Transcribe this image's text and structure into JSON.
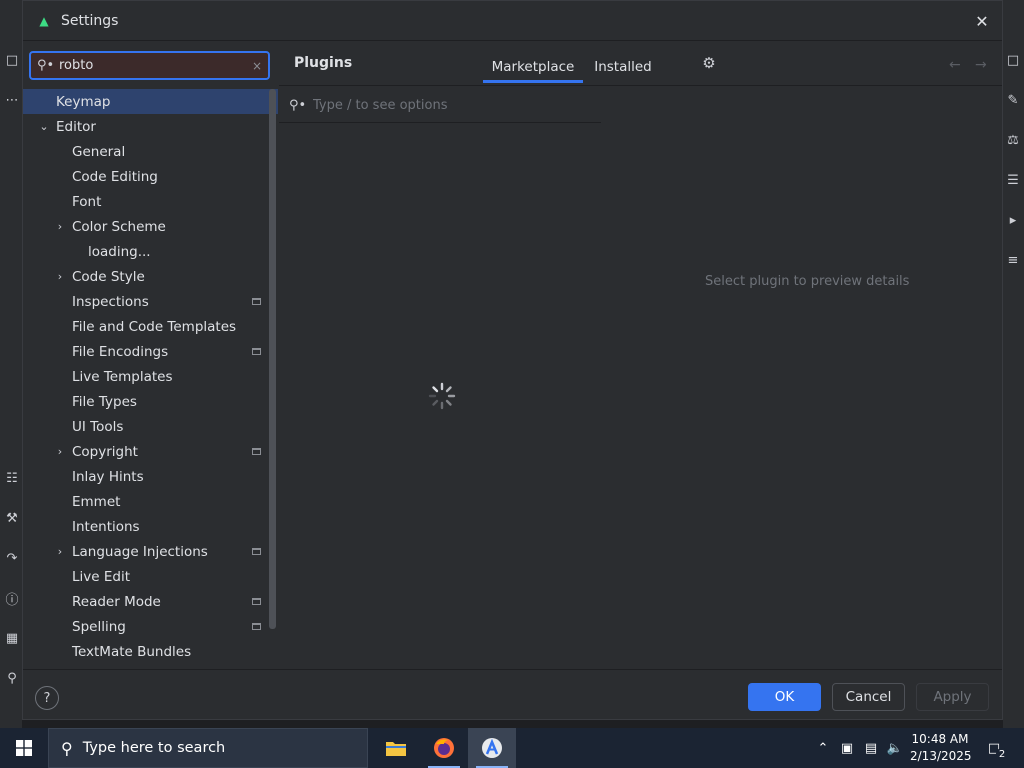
{
  "dialog": {
    "title": "Settings",
    "close_label": "✕"
  },
  "search": {
    "value": "robto",
    "clear_label": "×"
  },
  "tree": {
    "items": [
      {
        "label": "Keymap",
        "level": 0,
        "expandable": false,
        "selected": true,
        "project_icon": false
      },
      {
        "label": "Editor",
        "level": 0,
        "expandable": true,
        "expanded": true,
        "project_icon": false
      },
      {
        "label": "General",
        "level": 1,
        "expandable": false,
        "project_icon": false
      },
      {
        "label": "Code Editing",
        "level": 1,
        "expandable": false,
        "project_icon": false
      },
      {
        "label": "Font",
        "level": 1,
        "expandable": false,
        "project_icon": false
      },
      {
        "label": "Color Scheme",
        "level": 1,
        "expandable": true,
        "expanded": false,
        "project_icon": false
      },
      {
        "label": "loading...",
        "level": 2,
        "expandable": false,
        "project_icon": false
      },
      {
        "label": "Code Style",
        "level": 1,
        "expandable": true,
        "expanded": false,
        "project_icon": false
      },
      {
        "label": "Inspections",
        "level": 1,
        "expandable": false,
        "project_icon": true
      },
      {
        "label": "File and Code Templates",
        "level": 1,
        "expandable": false,
        "project_icon": false
      },
      {
        "label": "File Encodings",
        "level": 1,
        "expandable": false,
        "project_icon": true
      },
      {
        "label": "Live Templates",
        "level": 1,
        "expandable": false,
        "project_icon": false
      },
      {
        "label": "File Types",
        "level": 1,
        "expandable": false,
        "project_icon": false
      },
      {
        "label": "UI Tools",
        "level": 1,
        "expandable": false,
        "project_icon": false
      },
      {
        "label": "Copyright",
        "level": 1,
        "expandable": true,
        "expanded": false,
        "project_icon": true
      },
      {
        "label": "Inlay Hints",
        "level": 1,
        "expandable": false,
        "project_icon": false
      },
      {
        "label": "Emmet",
        "level": 1,
        "expandable": false,
        "project_icon": false
      },
      {
        "label": "Intentions",
        "level": 1,
        "expandable": false,
        "project_icon": false
      },
      {
        "label": "Language Injections",
        "level": 1,
        "expandable": true,
        "expanded": false,
        "project_icon": true
      },
      {
        "label": "Live Edit",
        "level": 1,
        "expandable": false,
        "project_icon": false
      },
      {
        "label": "Reader Mode",
        "level": 1,
        "expandable": false,
        "project_icon": true
      },
      {
        "label": "Spelling",
        "level": 1,
        "expandable": false,
        "project_icon": true
      },
      {
        "label": "TextMate Bundles",
        "level": 1,
        "expandable": false,
        "project_icon": false
      }
    ]
  },
  "plugins": {
    "title": "Plugins",
    "tabs": [
      {
        "label": "Marketplace",
        "active": true
      },
      {
        "label": "Installed",
        "active": false
      }
    ],
    "search_placeholder": "Type / to see options",
    "preview_message": "Select plugin to preview details",
    "loading": true
  },
  "footer": {
    "help_label": "?",
    "ok_label": "OK",
    "cancel_label": "Cancel",
    "apply_label": "Apply",
    "apply_enabled": false
  },
  "taskbar": {
    "search_placeholder": "Type here to search",
    "apps": [
      "file-explorer",
      "firefox",
      "android-studio"
    ],
    "active_app": "android-studio",
    "time": "10:48 AM",
    "date": "2/13/2025",
    "notification_count": "2"
  },
  "colors": {
    "accent": "#3574f0",
    "panel_bg": "#2b2d30",
    "selection": "#2e436e",
    "taskbar_bg": "#1b2433"
  }
}
